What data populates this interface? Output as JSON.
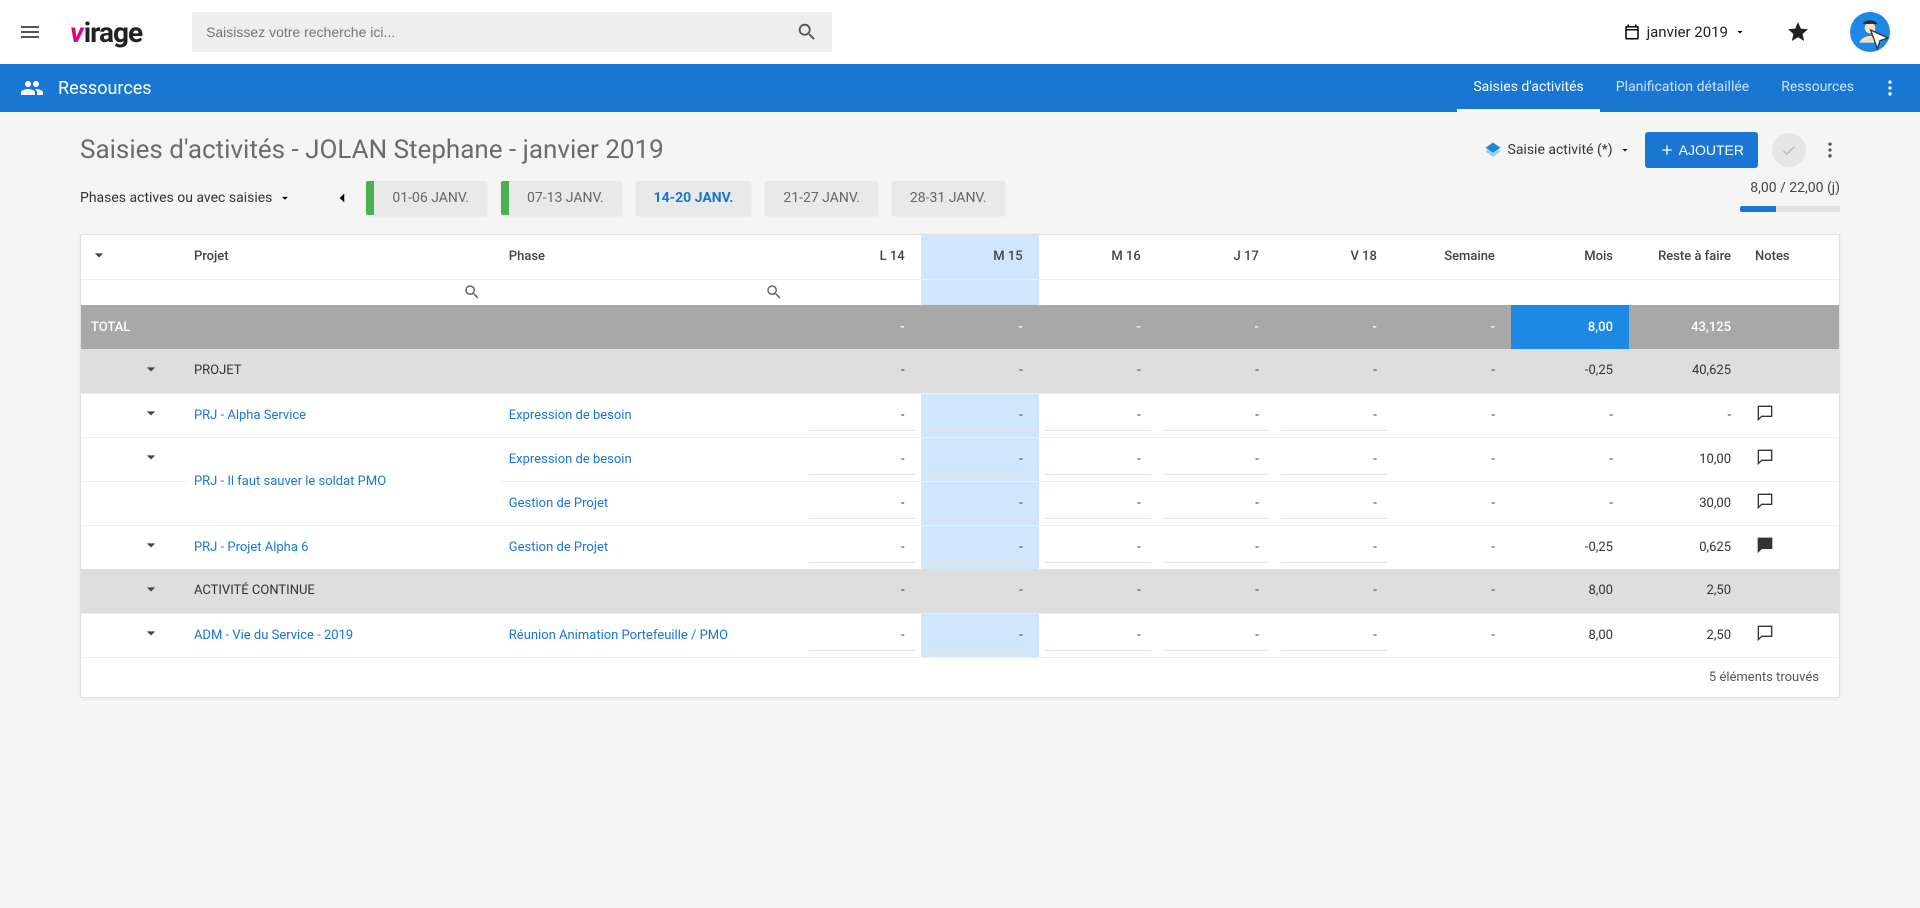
{
  "header": {
    "search_placeholder": "Saisissez votre recherche ici...",
    "period_label": "janvier 2019"
  },
  "bluenav": {
    "title": "Ressources",
    "tabs": [
      "Saisies d'activités",
      "Planification détaillée",
      "Ressources"
    ],
    "active": 0
  },
  "page": {
    "title": "Saisies d'activités - JOLAN Stephane - janvier 2019",
    "saisie_label": "Saisie activité (*)",
    "add_label": "AJOUTER",
    "phase_filter": "Phases actives ou avec saisies",
    "progress": {
      "text": "8,00 / 22,00 (j)",
      "pct": 36
    }
  },
  "weeks": [
    {
      "label": "01-06 JANV.",
      "bar": true,
      "active": false
    },
    {
      "label": "07-13 JANV.",
      "bar": true,
      "active": false
    },
    {
      "label": "14-20 JANV.",
      "bar": false,
      "active": true
    },
    {
      "label": "21-27 JANV.",
      "bar": false,
      "active": false
    },
    {
      "label": "28-31 JANV.",
      "bar": false,
      "active": false
    }
  ],
  "columns": {
    "projet": "Projet",
    "phase": "Phase",
    "days": [
      "L 14",
      "M 15",
      "M 16",
      "J 17",
      "V 18"
    ],
    "semaine": "Semaine",
    "mois": "Mois",
    "reste": "Reste à faire",
    "notes": "Notes",
    "hl_index": 1
  },
  "total": {
    "label": "TOTAL",
    "mois": "8,00",
    "reste": "43,125"
  },
  "groups": [
    {
      "label": "PROJET",
      "mois": "-0,25",
      "reste": "40,625",
      "rows": [
        {
          "proj": "PRJ - Alpha Service",
          "phases": [
            {
              "phase": "Expression de besoin",
              "mois": "-",
              "reste": "-",
              "note": "empty"
            }
          ]
        },
        {
          "proj": "PRJ - Il faut sauver le soldat PMO",
          "phases": [
            {
              "phase": "Expression de besoin",
              "mois": "-",
              "reste": "10,00",
              "note": "empty"
            },
            {
              "phase": "Gestion de Projet",
              "mois": "-",
              "reste": "30,00",
              "note": "empty"
            }
          ]
        },
        {
          "proj": "PRJ - Projet Alpha 6",
          "phases": [
            {
              "phase": "Gestion de Projet",
              "mois": "-0,25",
              "reste": "0,625",
              "note": "filled"
            }
          ]
        }
      ]
    },
    {
      "label": "ACTIVITÉ CONTINUE",
      "mois": "8,00",
      "reste": "2,50",
      "rows": [
        {
          "proj": "ADM - Vie du Service - 2019",
          "phases": [
            {
              "phase": "Réunion Animation Portefeuille / PMO",
              "mois": "8,00",
              "reste": "2,50",
              "note": "empty"
            }
          ]
        }
      ]
    }
  ],
  "footer": "5 éléments trouvés"
}
